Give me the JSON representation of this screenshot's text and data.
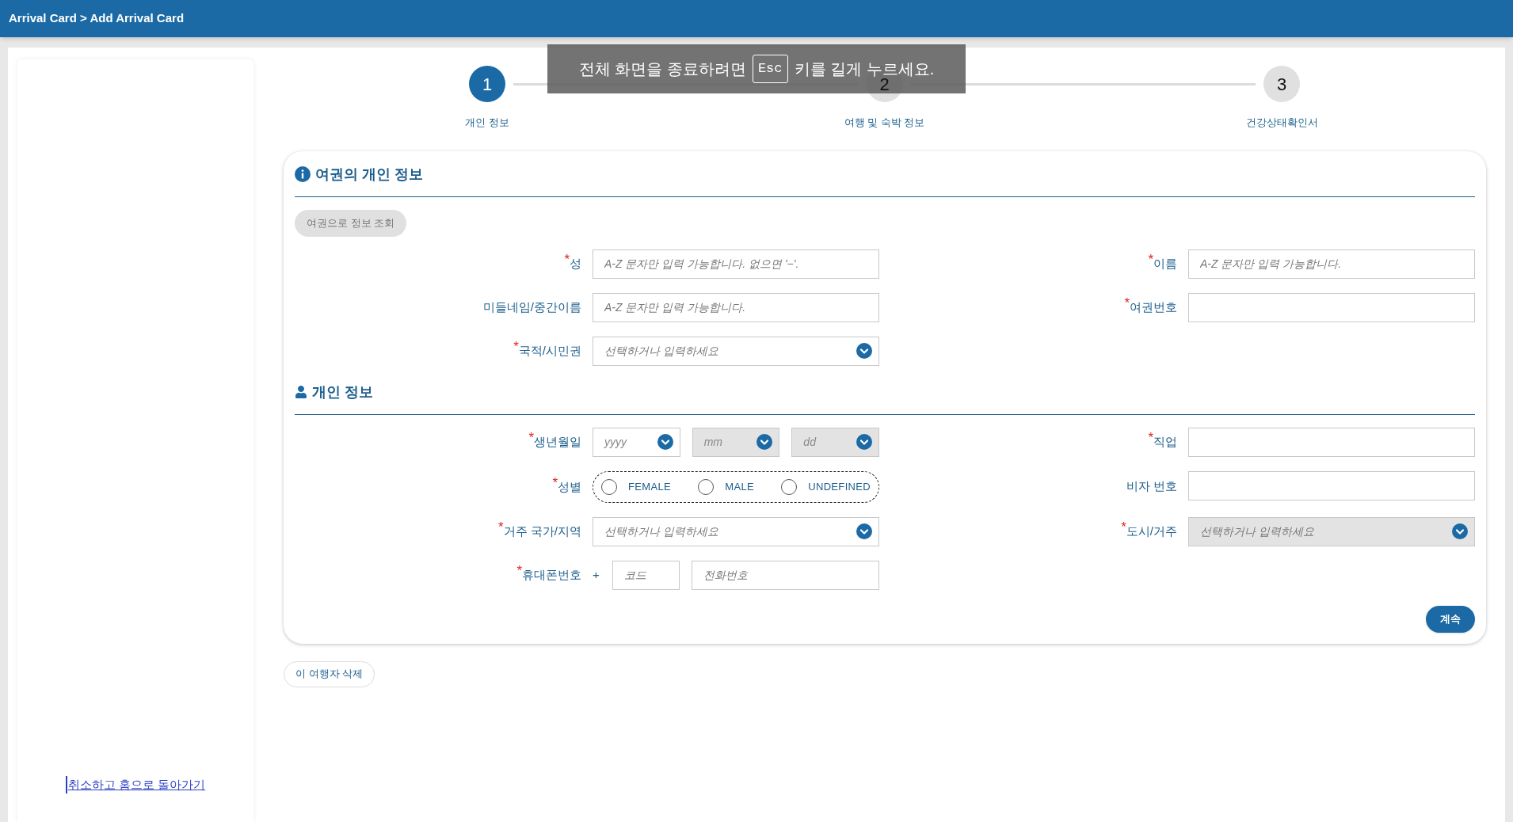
{
  "header": {
    "breadcrumb": "Arrival Card > Add Arrival Card"
  },
  "fullscreen_notice": {
    "before": "전체 화면을 종료하려면",
    "key": "Esc",
    "after": "키를 길게 누르세요."
  },
  "steps": [
    {
      "number": "1",
      "label": "개인 정보",
      "selected": true
    },
    {
      "number": "2",
      "label": "여행 및 숙박 정보",
      "selected": false
    },
    {
      "number": "3",
      "label": "건강상태확인서",
      "selected": false
    }
  ],
  "required_mark": "*",
  "sections": [
    {
      "title": "여권의 개인 정보",
      "lookup_button": {
        "label": "여권으로 정보 조회",
        "disabled": true
      },
      "rows": [
        {
          "left": {
            "kind": "text",
            "label": "성",
            "required": true,
            "placeholder": "A-Z 문자만 입력 가능합니다. 없으면 '−'.",
            "disabled": false
          },
          "right": {
            "kind": "text",
            "label": "이름",
            "required": true,
            "placeholder": "A-Z 문자만 입력 가능합니다.",
            "disabled": false
          }
        },
        {
          "left": {
            "kind": "text",
            "label": "미들네임/중간이름",
            "required": false,
            "placeholder": "A-Z 문자만 입력 가능합니다.",
            "disabled": false
          },
          "right": {
            "kind": "text",
            "label": "여권번호",
            "required": true,
            "disabled": false
          }
        },
        {
          "left": {
            "kind": "select",
            "label": "국적/시민권",
            "required": true,
            "placeholder": "선택하거나 입력하세요",
            "disabled": false
          }
        }
      ]
    },
    {
      "title": "개인 정보",
      "rows": [
        {
          "left": {
            "kind": "date",
            "label": "생년월일",
            "required": true,
            "parts": [
              {
                "placeholder": "yyyy",
                "disabled": false
              },
              {
                "placeholder": "mm",
                "disabled": true
              },
              {
                "placeholder": "dd",
                "disabled": true
              }
            ]
          },
          "right": {
            "kind": "text",
            "label": "직업",
            "required": true,
            "disabled": false
          }
        },
        {
          "left": {
            "kind": "radio",
            "label": "성별",
            "required": true,
            "options": [
              {
                "label": "FEMALE",
                "selected": false
              },
              {
                "label": "MALE",
                "selected": false
              },
              {
                "label": "UNDEFINED",
                "selected": false
              }
            ]
          },
          "right": {
            "kind": "text",
            "label": "비자 번호",
            "required": false,
            "disabled": false
          }
        },
        {
          "left": {
            "kind": "select",
            "label": "거주 국가/지역",
            "required": true,
            "placeholder": "선택하거나 입력하세요",
            "disabled": false
          },
          "right": {
            "kind": "select",
            "label": "도시/거주",
            "required": true,
            "placeholder": "선택하거나 입력하세요",
            "disabled": true
          }
        },
        {
          "left": {
            "kind": "phone",
            "label": "휴대폰번호",
            "required": true,
            "prefix": "+",
            "code_placeholder": "코드",
            "number_placeholder": "전화번호"
          }
        }
      ]
    }
  ],
  "continue_button": "계속",
  "delete_button": "이 여행자 삭제",
  "cancel_link": "취소하고 홈으로 돌아가기"
}
